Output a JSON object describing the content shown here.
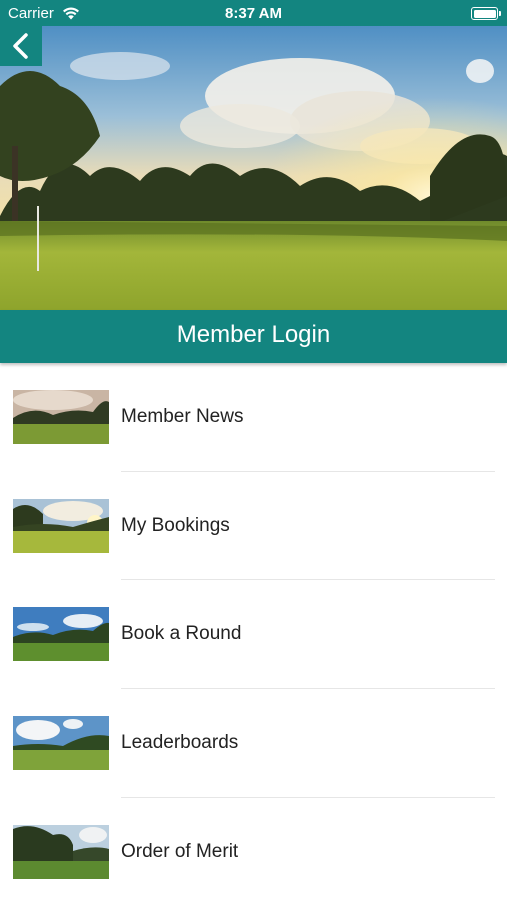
{
  "status_bar": {
    "carrier": "Carrier",
    "time": "8:37 AM",
    "wifi_icon": "wifi-icon",
    "battery_icon": "battery-icon"
  },
  "header": {
    "back_icon": "chevron-left-icon",
    "hero_image": "golf-course-sunrise-photo"
  },
  "login": {
    "label": "Member Login"
  },
  "menu": {
    "items": [
      {
        "label": "Member News",
        "thumbnail": "golf-course-sunset-thumbnail"
      },
      {
        "label": "My Bookings",
        "thumbnail": "golf-green-sunrise-thumbnail"
      },
      {
        "label": "Book a Round",
        "thumbnail": "fairway-blue-sky-thumbnail"
      },
      {
        "label": "Leaderboards",
        "thumbnail": "fairway-clouds-thumbnail"
      },
      {
        "label": "Order of Merit",
        "thumbnail": "golf-course-trees-thumbnail"
      }
    ]
  },
  "colors": {
    "brand_teal": "#138580",
    "text": "#222222",
    "divider": "#e6e6e6"
  }
}
